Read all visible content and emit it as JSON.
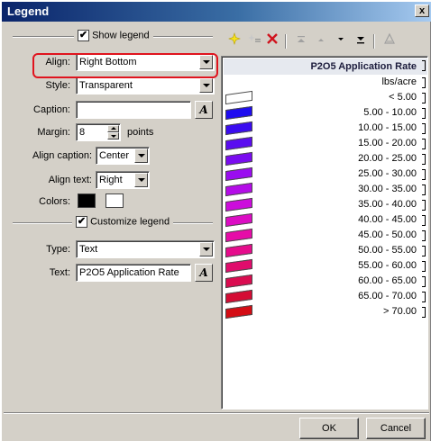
{
  "window": {
    "title": "Legend",
    "close_glyph": "x"
  },
  "show_legend": {
    "label": "Show legend",
    "checked": true
  },
  "align": {
    "label": "Align:",
    "value": "Right Bottom"
  },
  "style": {
    "label": "Style:",
    "value": "Transparent"
  },
  "caption": {
    "label": "Caption:",
    "value": ""
  },
  "margin": {
    "label": "Margin:",
    "value": "8",
    "unit": "points"
  },
  "align_caption": {
    "label": "Align caption:",
    "value": "Center"
  },
  "align_text": {
    "label": "Align text:",
    "value": "Right"
  },
  "colors": {
    "label": "Colors:",
    "primary": "#000000",
    "secondary": "#ffffff"
  },
  "customize_legend": {
    "label": "Customize legend",
    "checked": true
  },
  "type": {
    "label": "Type:",
    "value": "Text"
  },
  "text": {
    "label": "Text:",
    "value": "P2O5 Application Rate"
  },
  "a_button": "A",
  "toolbar": [
    "add-item-icon",
    "add-all-icon",
    "delete-icon",
    "move-top-icon",
    "move-up-icon",
    "move-down-icon",
    "move-bottom-icon",
    "sort-icon"
  ],
  "legend_list": {
    "header": "P2O5 Application Rate",
    "items": [
      {
        "label": "lbs/acre",
        "color": ""
      },
      {
        "label": "< 5.00",
        "color": "#ffffff"
      },
      {
        "label": "5.00 - 10.00",
        "color": "#1e0cf0"
      },
      {
        "label": "10.00 - 15.00",
        "color": "#3a0cf0"
      },
      {
        "label": "15.00 - 20.00",
        "color": "#5a0cf0"
      },
      {
        "label": "20.00 - 25.00",
        "color": "#7a0cf0"
      },
      {
        "label": "25.00 - 30.00",
        "color": "#9a0cf0"
      },
      {
        "label": "30.00 - 35.00",
        "color": "#b40ce8"
      },
      {
        "label": "35.00 - 40.00",
        "color": "#cc0cdc"
      },
      {
        "label": "40.00 - 45.00",
        "color": "#dc0cc4"
      },
      {
        "label": "45.00 - 50.00",
        "color": "#e60ca8"
      },
      {
        "label": "50.00 - 55.00",
        "color": "#e60c8c"
      },
      {
        "label": "55.00 - 60.00",
        "color": "#e00c6c"
      },
      {
        "label": "60.00 - 65.00",
        "color": "#da0c50"
      },
      {
        "label": "65.00 - 70.00",
        "color": "#d40c34"
      },
      {
        "label": "> 70.00",
        "color": "#d40c14"
      }
    ]
  },
  "buttons": {
    "ok": "OK",
    "cancel": "Cancel"
  }
}
